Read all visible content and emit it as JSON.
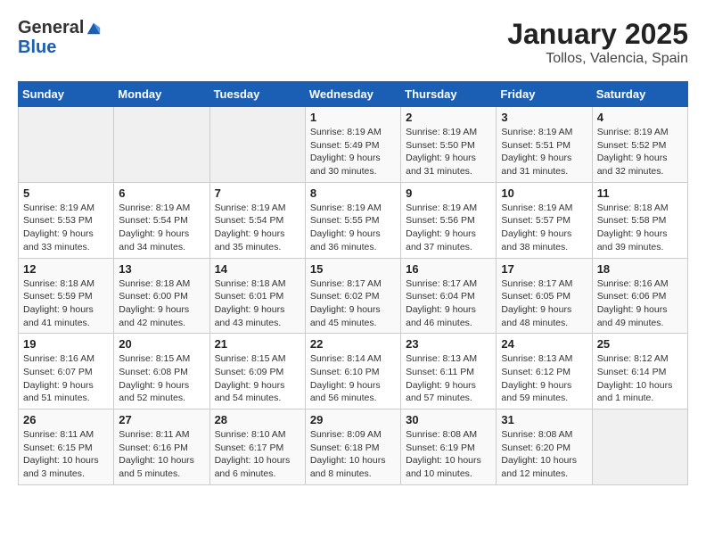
{
  "logo": {
    "general": "General",
    "blue": "Blue"
  },
  "title": "January 2025",
  "subtitle": "Tollos, Valencia, Spain",
  "headers": [
    "Sunday",
    "Monday",
    "Tuesday",
    "Wednesday",
    "Thursday",
    "Friday",
    "Saturday"
  ],
  "weeks": [
    [
      {
        "day": "",
        "info": ""
      },
      {
        "day": "",
        "info": ""
      },
      {
        "day": "",
        "info": ""
      },
      {
        "day": "1",
        "info": "Sunrise: 8:19 AM\nSunset: 5:49 PM\nDaylight: 9 hours\nand 30 minutes."
      },
      {
        "day": "2",
        "info": "Sunrise: 8:19 AM\nSunset: 5:50 PM\nDaylight: 9 hours\nand 31 minutes."
      },
      {
        "day": "3",
        "info": "Sunrise: 8:19 AM\nSunset: 5:51 PM\nDaylight: 9 hours\nand 31 minutes."
      },
      {
        "day": "4",
        "info": "Sunrise: 8:19 AM\nSunset: 5:52 PM\nDaylight: 9 hours\nand 32 minutes."
      }
    ],
    [
      {
        "day": "5",
        "info": "Sunrise: 8:19 AM\nSunset: 5:53 PM\nDaylight: 9 hours\nand 33 minutes."
      },
      {
        "day": "6",
        "info": "Sunrise: 8:19 AM\nSunset: 5:54 PM\nDaylight: 9 hours\nand 34 minutes."
      },
      {
        "day": "7",
        "info": "Sunrise: 8:19 AM\nSunset: 5:54 PM\nDaylight: 9 hours\nand 35 minutes."
      },
      {
        "day": "8",
        "info": "Sunrise: 8:19 AM\nSunset: 5:55 PM\nDaylight: 9 hours\nand 36 minutes."
      },
      {
        "day": "9",
        "info": "Sunrise: 8:19 AM\nSunset: 5:56 PM\nDaylight: 9 hours\nand 37 minutes."
      },
      {
        "day": "10",
        "info": "Sunrise: 8:19 AM\nSunset: 5:57 PM\nDaylight: 9 hours\nand 38 minutes."
      },
      {
        "day": "11",
        "info": "Sunrise: 8:18 AM\nSunset: 5:58 PM\nDaylight: 9 hours\nand 39 minutes."
      }
    ],
    [
      {
        "day": "12",
        "info": "Sunrise: 8:18 AM\nSunset: 5:59 PM\nDaylight: 9 hours\nand 41 minutes."
      },
      {
        "day": "13",
        "info": "Sunrise: 8:18 AM\nSunset: 6:00 PM\nDaylight: 9 hours\nand 42 minutes."
      },
      {
        "day": "14",
        "info": "Sunrise: 8:18 AM\nSunset: 6:01 PM\nDaylight: 9 hours\nand 43 minutes."
      },
      {
        "day": "15",
        "info": "Sunrise: 8:17 AM\nSunset: 6:02 PM\nDaylight: 9 hours\nand 45 minutes."
      },
      {
        "day": "16",
        "info": "Sunrise: 8:17 AM\nSunset: 6:04 PM\nDaylight: 9 hours\nand 46 minutes."
      },
      {
        "day": "17",
        "info": "Sunrise: 8:17 AM\nSunset: 6:05 PM\nDaylight: 9 hours\nand 48 minutes."
      },
      {
        "day": "18",
        "info": "Sunrise: 8:16 AM\nSunset: 6:06 PM\nDaylight: 9 hours\nand 49 minutes."
      }
    ],
    [
      {
        "day": "19",
        "info": "Sunrise: 8:16 AM\nSunset: 6:07 PM\nDaylight: 9 hours\nand 51 minutes."
      },
      {
        "day": "20",
        "info": "Sunrise: 8:15 AM\nSunset: 6:08 PM\nDaylight: 9 hours\nand 52 minutes."
      },
      {
        "day": "21",
        "info": "Sunrise: 8:15 AM\nSunset: 6:09 PM\nDaylight: 9 hours\nand 54 minutes."
      },
      {
        "day": "22",
        "info": "Sunrise: 8:14 AM\nSunset: 6:10 PM\nDaylight: 9 hours\nand 56 minutes."
      },
      {
        "day": "23",
        "info": "Sunrise: 8:13 AM\nSunset: 6:11 PM\nDaylight: 9 hours\nand 57 minutes."
      },
      {
        "day": "24",
        "info": "Sunrise: 8:13 AM\nSunset: 6:12 PM\nDaylight: 9 hours\nand 59 minutes."
      },
      {
        "day": "25",
        "info": "Sunrise: 8:12 AM\nSunset: 6:14 PM\nDaylight: 10 hours\nand 1 minute."
      }
    ],
    [
      {
        "day": "26",
        "info": "Sunrise: 8:11 AM\nSunset: 6:15 PM\nDaylight: 10 hours\nand 3 minutes."
      },
      {
        "day": "27",
        "info": "Sunrise: 8:11 AM\nSunset: 6:16 PM\nDaylight: 10 hours\nand 5 minutes."
      },
      {
        "day": "28",
        "info": "Sunrise: 8:10 AM\nSunset: 6:17 PM\nDaylight: 10 hours\nand 6 minutes."
      },
      {
        "day": "29",
        "info": "Sunrise: 8:09 AM\nSunset: 6:18 PM\nDaylight: 10 hours\nand 8 minutes."
      },
      {
        "day": "30",
        "info": "Sunrise: 8:08 AM\nSunset: 6:19 PM\nDaylight: 10 hours\nand 10 minutes."
      },
      {
        "day": "31",
        "info": "Sunrise: 8:08 AM\nSunset: 6:20 PM\nDaylight: 10 hours\nand 12 minutes."
      },
      {
        "day": "",
        "info": ""
      }
    ]
  ]
}
